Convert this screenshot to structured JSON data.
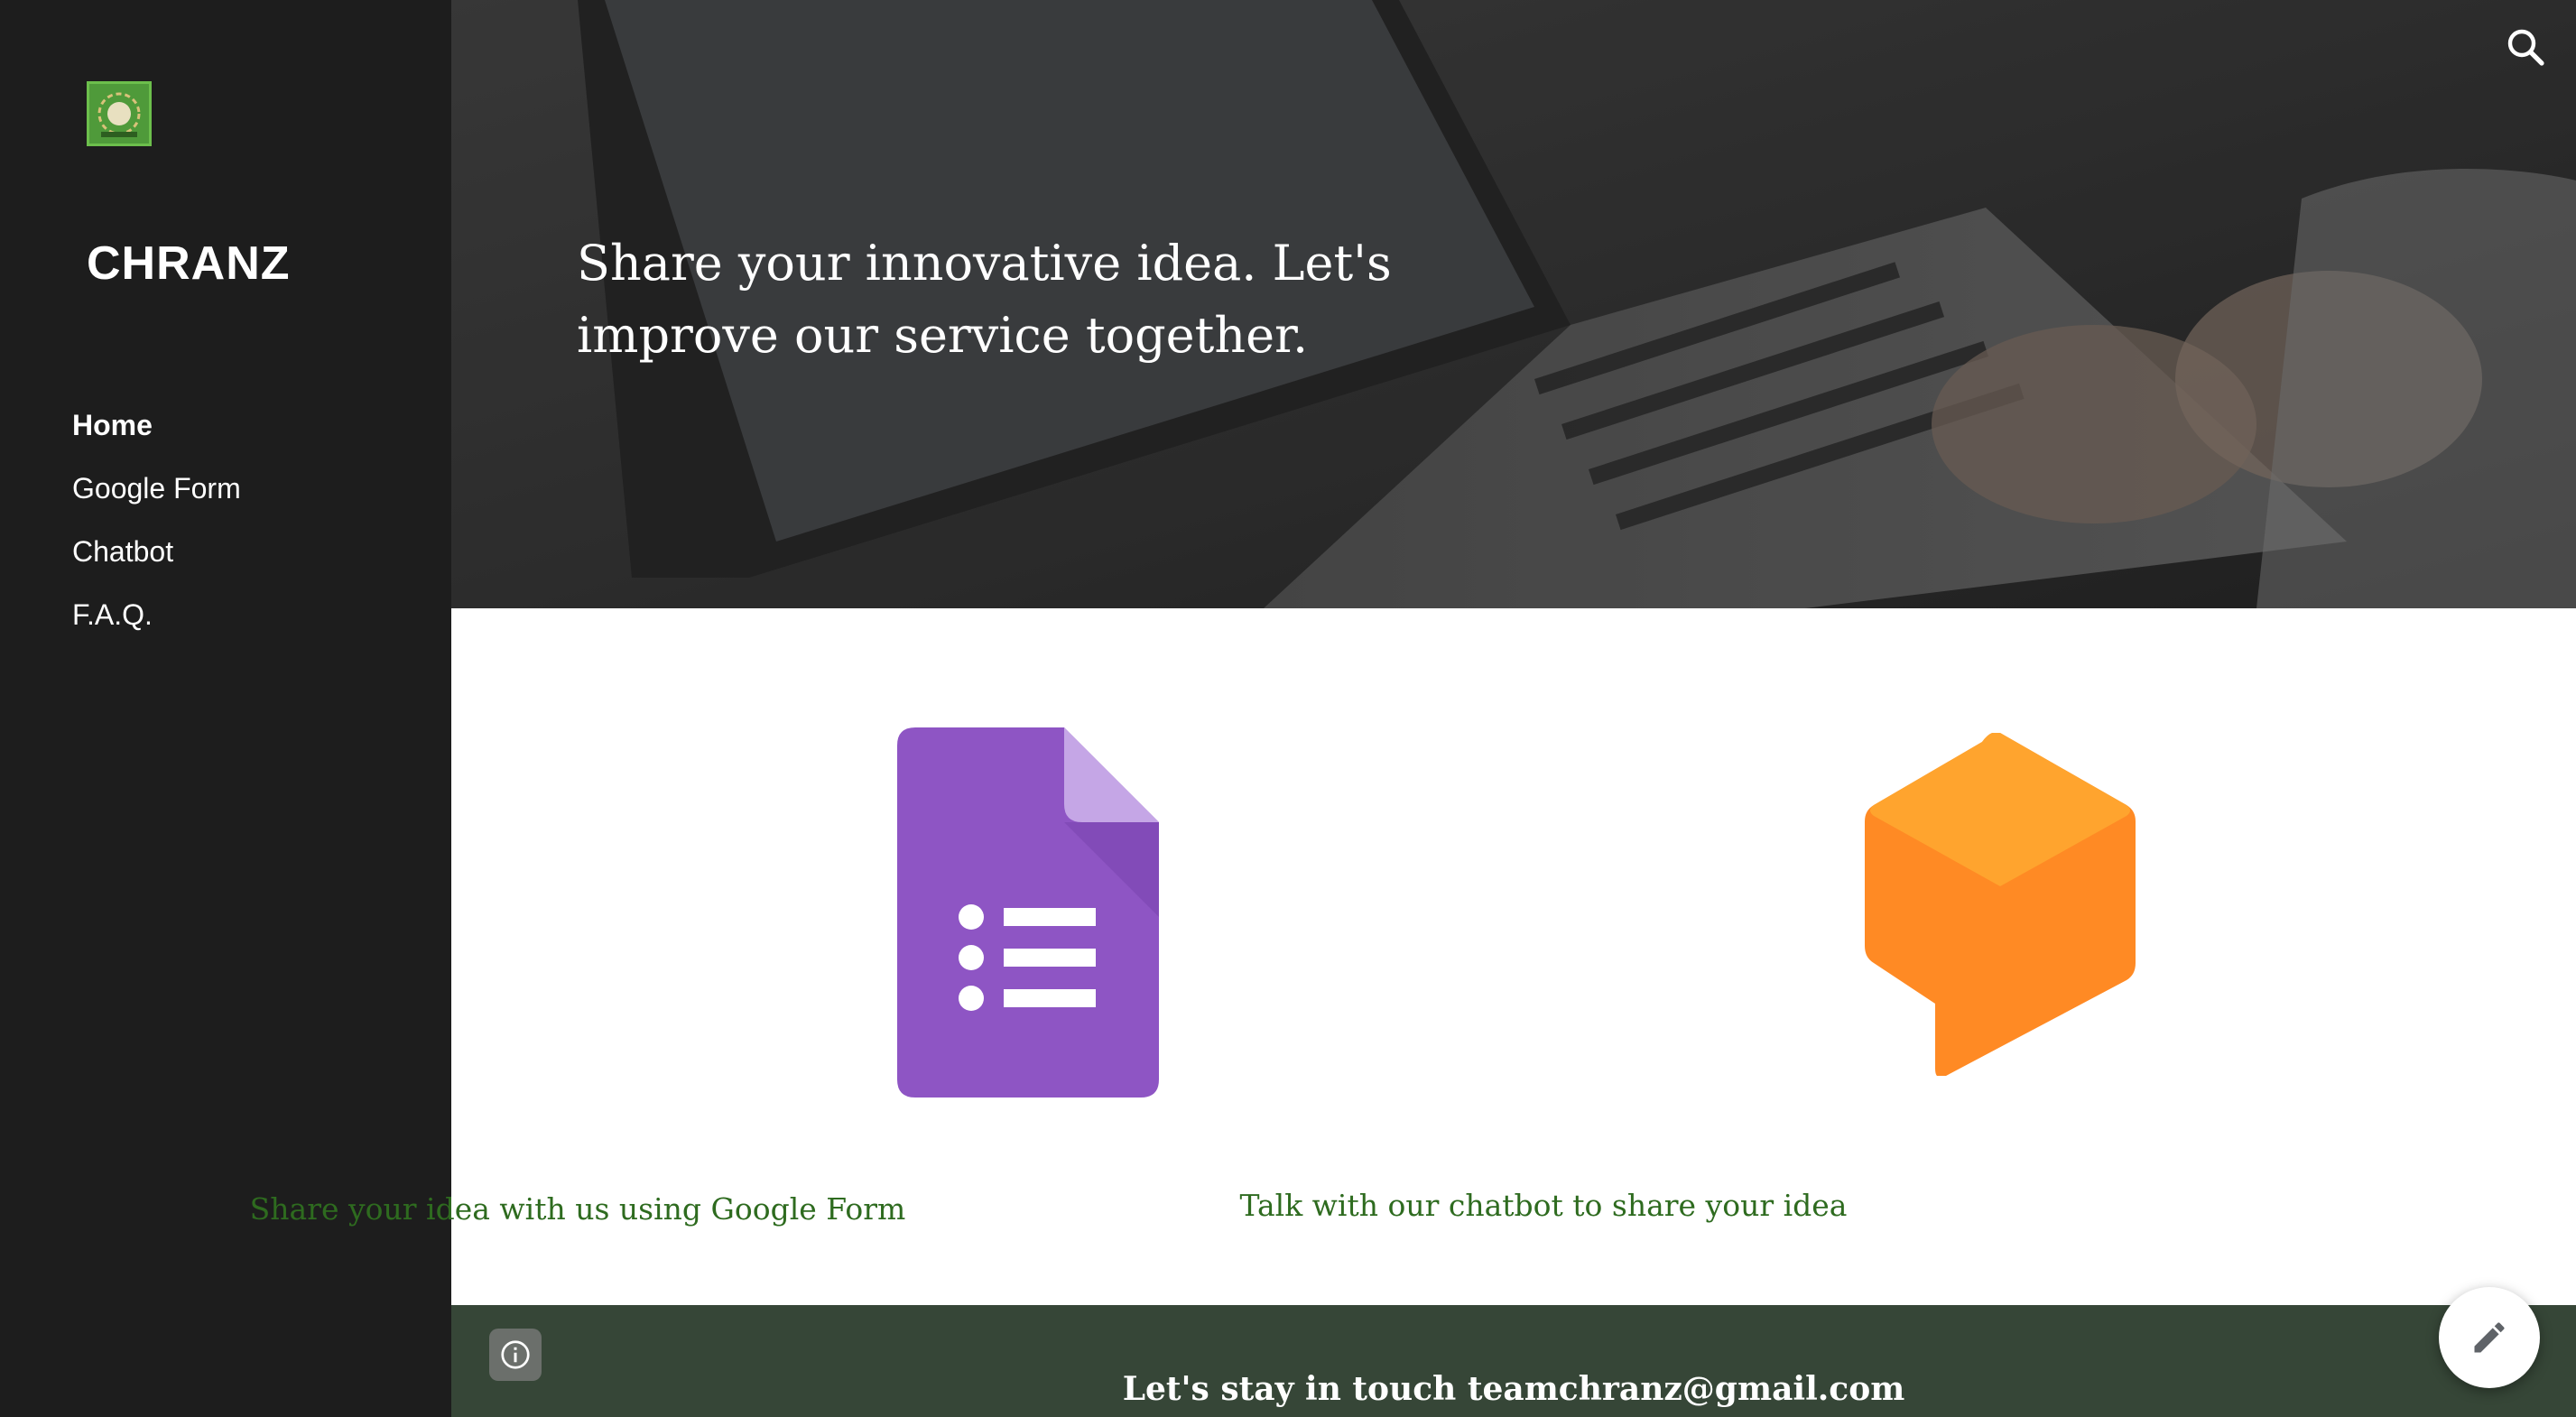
{
  "site": {
    "title": "CHRANZ",
    "logo_icon": "laurel-wreath-logo-icon"
  },
  "sidebar": {
    "nav": [
      {
        "label": "Home",
        "active": true
      },
      {
        "label": "Google Form",
        "active": false
      },
      {
        "label": "Chatbot",
        "active": false
      },
      {
        "label": "F.A.Q.",
        "active": false
      }
    ]
  },
  "hero": {
    "headline": "Share your innovative idea. Let's improve our service together.",
    "search_icon": "search-icon"
  },
  "cards": [
    {
      "icon": "google-forms-icon",
      "link_text": "Share your idea with us using Google Form"
    },
    {
      "icon": "dialogflow-chatbot-icon",
      "link_text": "Talk with our chatbot to share your idea"
    }
  ],
  "footer": {
    "text": "Let's stay in touch teamchranz@gmail.com",
    "info_icon": "info-icon"
  },
  "fab": {
    "icon": "pencil-edit-icon"
  },
  "colors": {
    "sidebar_bg": "#1d1d1d",
    "footer_bg": "#364637",
    "link_green": "#2e6b1f",
    "forms_purple": "#8e55c4",
    "chatbot_orange": "#ff8a24"
  }
}
